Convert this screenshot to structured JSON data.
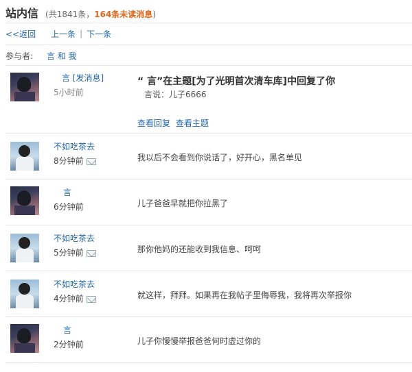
{
  "header": {
    "title": "站内信",
    "count_prefix": "(共1841条，",
    "unread": "164条未读消息",
    "count_suffix": ")"
  },
  "nav": {
    "back": "<<返回",
    "prev": "上一条",
    "divider": "|",
    "next": "下一条"
  },
  "participants": {
    "label": "参与者:",
    "names": "言 和 我"
  },
  "notification": {
    "name": "言",
    "send_link": "[发消息]",
    "time": "5小时前",
    "title": "“  言”在主题[为了光明首次清车库]中回复了你",
    "quote": "言说：儿子6666",
    "view_reply": "查看回复",
    "view_topic": "查看主题"
  },
  "messages": [
    {
      "name": "不如吃茶去",
      "time": "8分钟前",
      "text": "我以后不会看到你说话了，好开心，黑名单见"
    },
    {
      "name": "言",
      "time": "6分钟前",
      "text": "儿子爸爸早就把你拉黑了"
    },
    {
      "name": "不如吃茶去",
      "time": "5分钟前",
      "text": "那你他妈的还能收到我信息、呵呵"
    },
    {
      "name": "不如吃茶去",
      "time": "4分钟前",
      "text": "就这样，拜拜。如果再在我帖子里侮辱我，我将再次举报你"
    },
    {
      "name": "言",
      "time": "2分钟前",
      "text": "儿子你慢慢举报爸爸何时虚过你的"
    }
  ]
}
